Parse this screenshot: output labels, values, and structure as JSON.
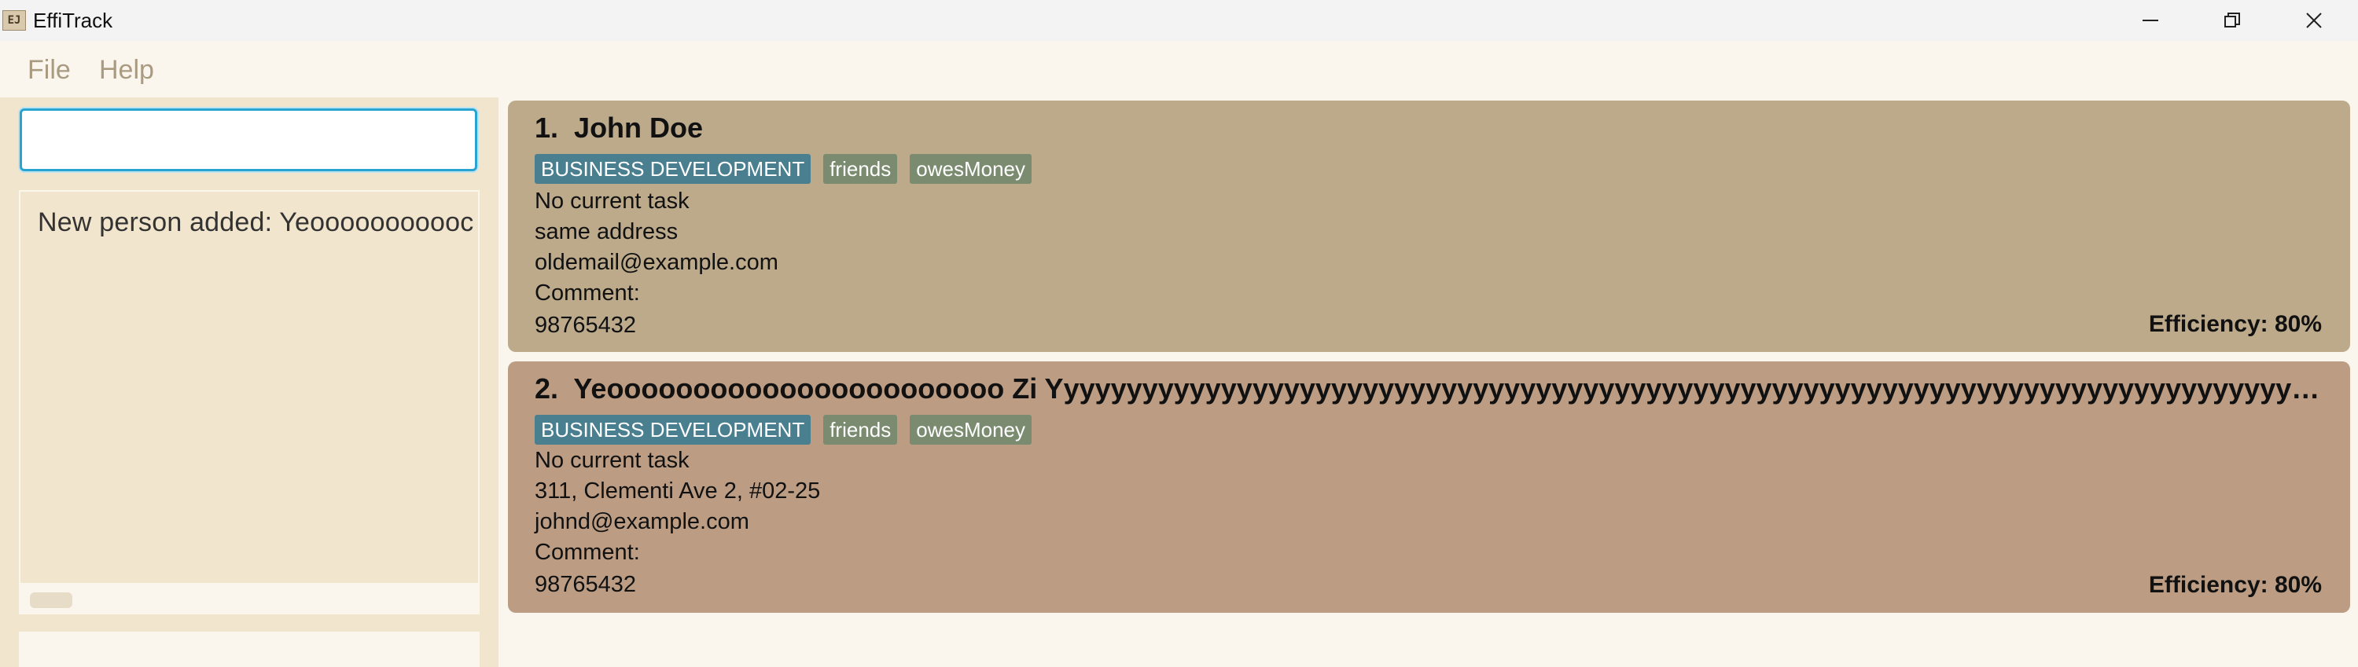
{
  "window": {
    "title": "EffiTrack",
    "app_icon_text": "EJ",
    "controls": [
      "minimize-icon",
      "restore-icon",
      "close-icon"
    ]
  },
  "menu": {
    "items": [
      {
        "label": "File"
      },
      {
        "label": "Help"
      }
    ]
  },
  "command_box": {
    "value": "",
    "placeholder": ""
  },
  "result": {
    "text": "New person added: Yeooooooooooc"
  },
  "persons": [
    {
      "index": "1.",
      "name": "John Doe",
      "tags": [
        "BUSINESS DEVELOPMENT",
        "friends",
        "owesMoney"
      ],
      "task": "No current task",
      "address": "same address",
      "email": "oldemail@example.com",
      "comment": "Comment:",
      "phone": "98765432",
      "efficiency": "Efficiency: 80%",
      "card_color": "#bcaa8b"
    },
    {
      "index": "2.",
      "name": "Yeooooooooooooooooooooooo Zi Yyyyyyyyyyyyyyyyyyyyyyyyyyyyyyyyyyyyyyyyyyyyyyyyyyyyyyyyyyyyyyyyyyyyyyyyyyyyyyyyyyyyyyyyyy...",
      "tags": [
        "BUSINESS DEVELOPMENT",
        "friends",
        "owesMoney"
      ],
      "task": "No current task",
      "address": "311, Clementi Ave 2, #02-25",
      "email": "johnd@example.com",
      "comment": "Comment:",
      "phone": "98765432",
      "efficiency": "Efficiency: 80%",
      "card_color": "#bc9d83"
    }
  ]
}
